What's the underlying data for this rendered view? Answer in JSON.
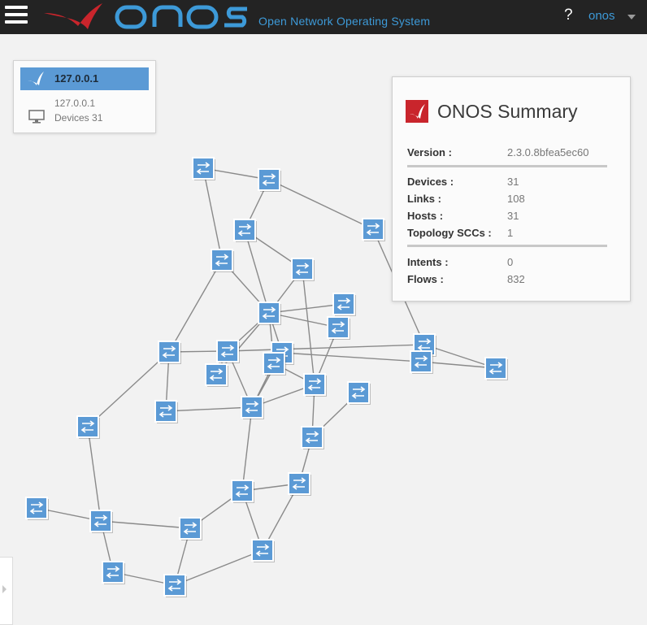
{
  "app": {
    "subtitle": "Open Network Operating System",
    "help_label": "?",
    "user_label": "onos",
    "brand_color": "#c9252c",
    "accent_color": "#3d9ad8",
    "topbar_color": "#232323"
  },
  "instance_panel": {
    "header_title": "127.0.0.1",
    "instance_ip": "127.0.0.1",
    "devices_line": "Devices 31",
    "icons": [
      "onos-bird-icon",
      "monitor-icon"
    ]
  },
  "summary": {
    "title": "ONOS Summary",
    "version": {
      "label": "Version :",
      "value": "2.3.0.8bfea5ec60"
    },
    "devices": {
      "label": "Devices :",
      "value": "31"
    },
    "links": {
      "label": "Links :",
      "value": "108"
    },
    "hosts": {
      "label": "Hosts :",
      "value": "31"
    },
    "sccs": {
      "label": "Topology SCCs :",
      "value": "1"
    },
    "intents": {
      "label": "Intents :",
      "value": "0"
    },
    "flows": {
      "label": "Flows :",
      "value": "832"
    }
  },
  "topology": {
    "device_icon": "switch-icon",
    "device_count": 31,
    "link_color": "#8a8a8a",
    "device_color": "#5b9ad5"
  }
}
